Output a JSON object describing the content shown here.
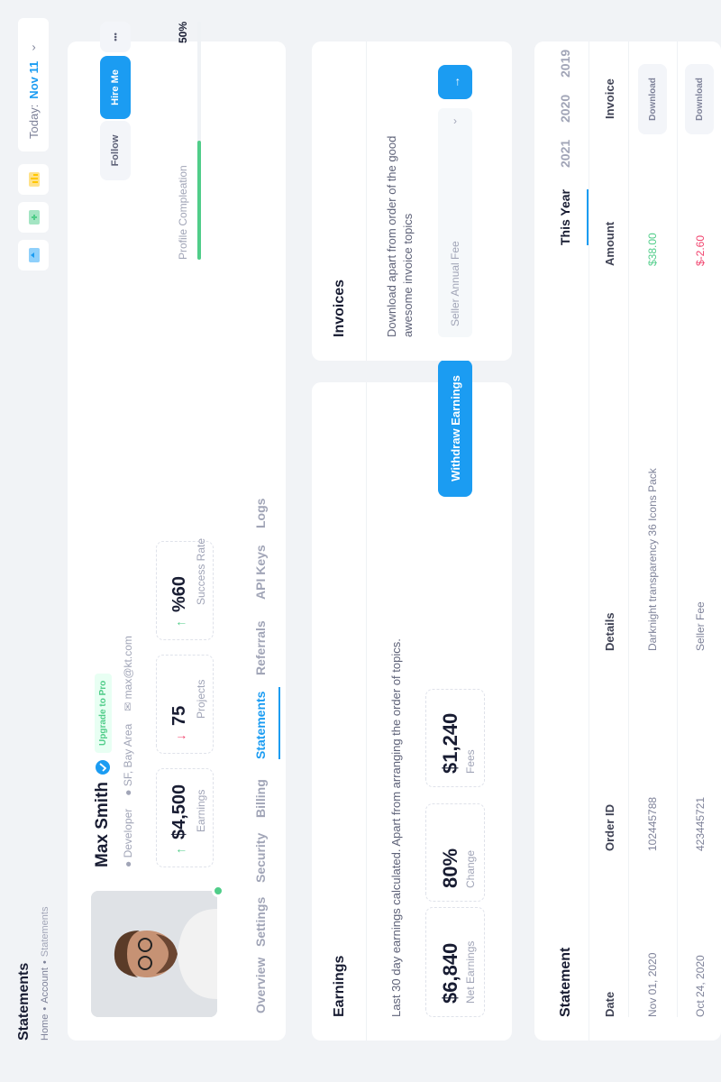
{
  "header": {
    "title": "Statements",
    "breadcrumb": [
      "Home",
      "Account",
      "Statements"
    ],
    "today_label": "Today:",
    "today_value": "Nov 11",
    "chevron": "›"
  },
  "profile": {
    "name": "Max Smith",
    "badge": "Upgrade to Pro",
    "role": "Developer",
    "location": "SF, Bay Area",
    "email": "max@kt.com",
    "follow": "Follow",
    "hire": "Hire Me",
    "more": "•••",
    "stats": [
      {
        "value": "$4,500",
        "label": "Earnings",
        "arrow": "↑"
      },
      {
        "value": "75",
        "label": "Projects",
        "arrow": "↓"
      },
      {
        "value": "%60",
        "label": "Success Rate",
        "arrow": "↑"
      }
    ],
    "completion_label": "Profile Compleation",
    "completion_value": "50%",
    "completion_fraction": 0.5,
    "tabs": [
      "Overview",
      "Settings",
      "Security",
      "Billing",
      "Statements",
      "Referrals",
      "API Keys",
      "Logs"
    ],
    "active_tab": "Statements"
  },
  "earnings": {
    "title": "Earnings",
    "description": "Last 30 day earnings calculated. Apart from arranging the order of topics.",
    "stats": [
      {
        "value": "$6,840",
        "label": "Net Earnings"
      },
      {
        "value": "80%",
        "label": "Change"
      },
      {
        "value": "$1,240",
        "label": "Fees"
      }
    ],
    "button": "Withdraw Earnings"
  },
  "invoices": {
    "title": "Invoices",
    "description": "Download apart from order of the good awesome invoice topics",
    "select_placeholder": "Seller Annual Fee",
    "chevron": "›",
    "arrow": "→"
  },
  "statement": {
    "title": "Statement",
    "year_tabs": [
      "This Year",
      "2021",
      "2020",
      "2019"
    ],
    "active_year": "This Year",
    "columns": [
      "Date",
      "Order ID",
      "Details",
      "Amount",
      "Invoice"
    ],
    "rows": [
      {
        "date": "Nov 01, 2020",
        "order": "102445788",
        "details": "Darknight transparency 36 Icons Pack",
        "amount": "$38.00",
        "invoice": "Download",
        "positive": true
      },
      {
        "date": "Oct 24, 2020",
        "order": "423445721",
        "details": "Seller Fee",
        "amount": "$-2.60",
        "invoice": "Download",
        "positive": false
      }
    ]
  },
  "colors": {
    "primary": "#1b9cf2",
    "success": "#50cd89",
    "danger": "#f1416c",
    "muted": "#a1a5b7",
    "background": "#f1f3f6"
  }
}
